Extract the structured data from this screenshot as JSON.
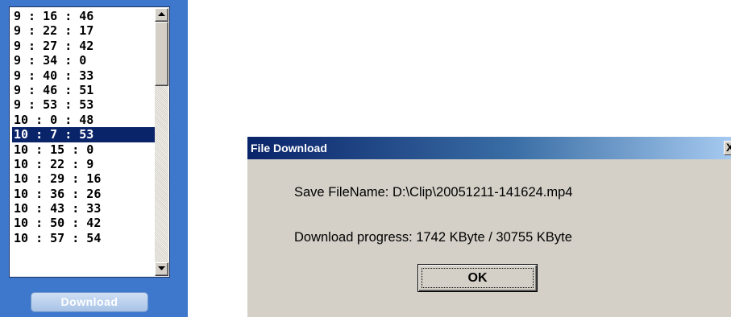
{
  "time_list": {
    "items": [
      "9 : 16 : 46",
      "9 : 22 : 17",
      "9 : 27 : 42",
      "9 : 34 : 0",
      "9 : 40 : 33",
      "9 : 46 : 51",
      "9 : 53 : 53",
      "10 : 0 : 48",
      "10 : 7 : 53",
      "10 : 15 : 0",
      "10 : 22 : 9",
      "10 : 29 : 16",
      "10 : 36 : 26",
      "10 : 43 : 33",
      "10 : 50 : 42",
      "10 : 57 : 54"
    ],
    "selected": "10 : 7 : 53"
  },
  "download_button": {
    "label": "Download"
  },
  "dialog": {
    "title": "File Download",
    "close_label": "X",
    "save_filename": "Save FileName: D:\\Clip\\20051211-141624.mp4",
    "download_progress": "Download progress: 1742 KByte / 30755 KByte",
    "ok_label": "OK"
  },
  "colors": {
    "panel_bg": "#3e78cc",
    "selection": "#0a246a",
    "dialog_bg": "#d4d0c8",
    "titlebar": "#0a246a"
  },
  "icons": [
    "scroll-up-arrow-icon",
    "scroll-down-arrow-icon",
    "close-icon"
  ]
}
